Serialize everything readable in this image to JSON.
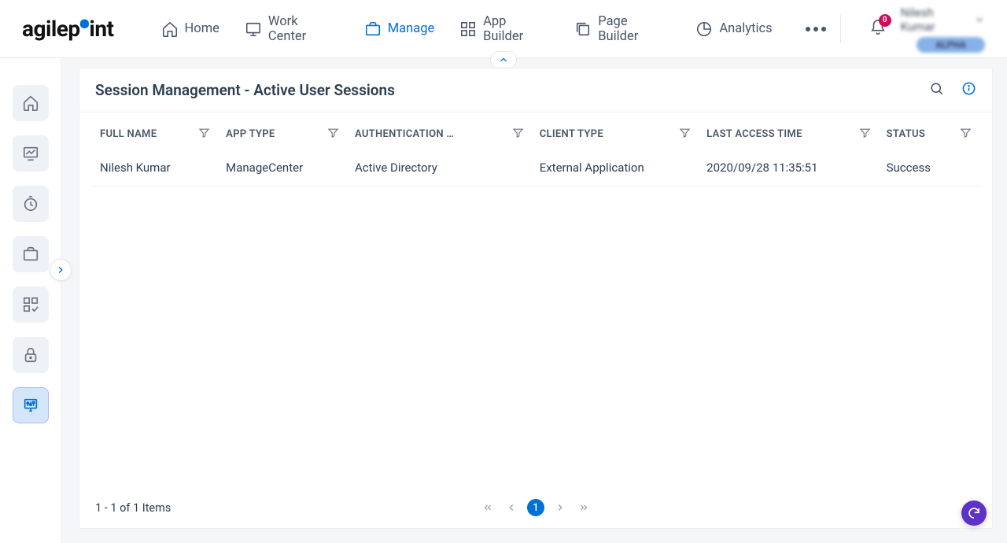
{
  "logo": {
    "text_left": "agilep",
    "text_right": "int"
  },
  "topnav": {
    "items": [
      {
        "label": "Home"
      },
      {
        "label": "Work Center"
      },
      {
        "label": "Manage"
      },
      {
        "label": "App Builder"
      },
      {
        "label": "Page Builder"
      },
      {
        "label": "Analytics"
      }
    ],
    "bell_count": "0",
    "user_name": "Nilesh Kumar",
    "alpha_badge": "ALPHA"
  },
  "panel": {
    "title": "Session Management - Active User Sessions"
  },
  "table": {
    "columns": [
      {
        "label": "FULL NAME"
      },
      {
        "label": "APP TYPE"
      },
      {
        "label": "AUTHENTICATION …"
      },
      {
        "label": "CLIENT TYPE"
      },
      {
        "label": "LAST ACCESS TIME"
      },
      {
        "label": "STATUS"
      }
    ],
    "rows": [
      {
        "full_name": "Nilesh Kumar",
        "app_type": "ManageCenter",
        "auth": "Active Directory",
        "client_type": "External Application",
        "last_access": "2020/09/28 11:35:51",
        "status": "Success"
      }
    ]
  },
  "pager": {
    "info": "1 - 1 of 1 Items",
    "current_page": "1"
  }
}
